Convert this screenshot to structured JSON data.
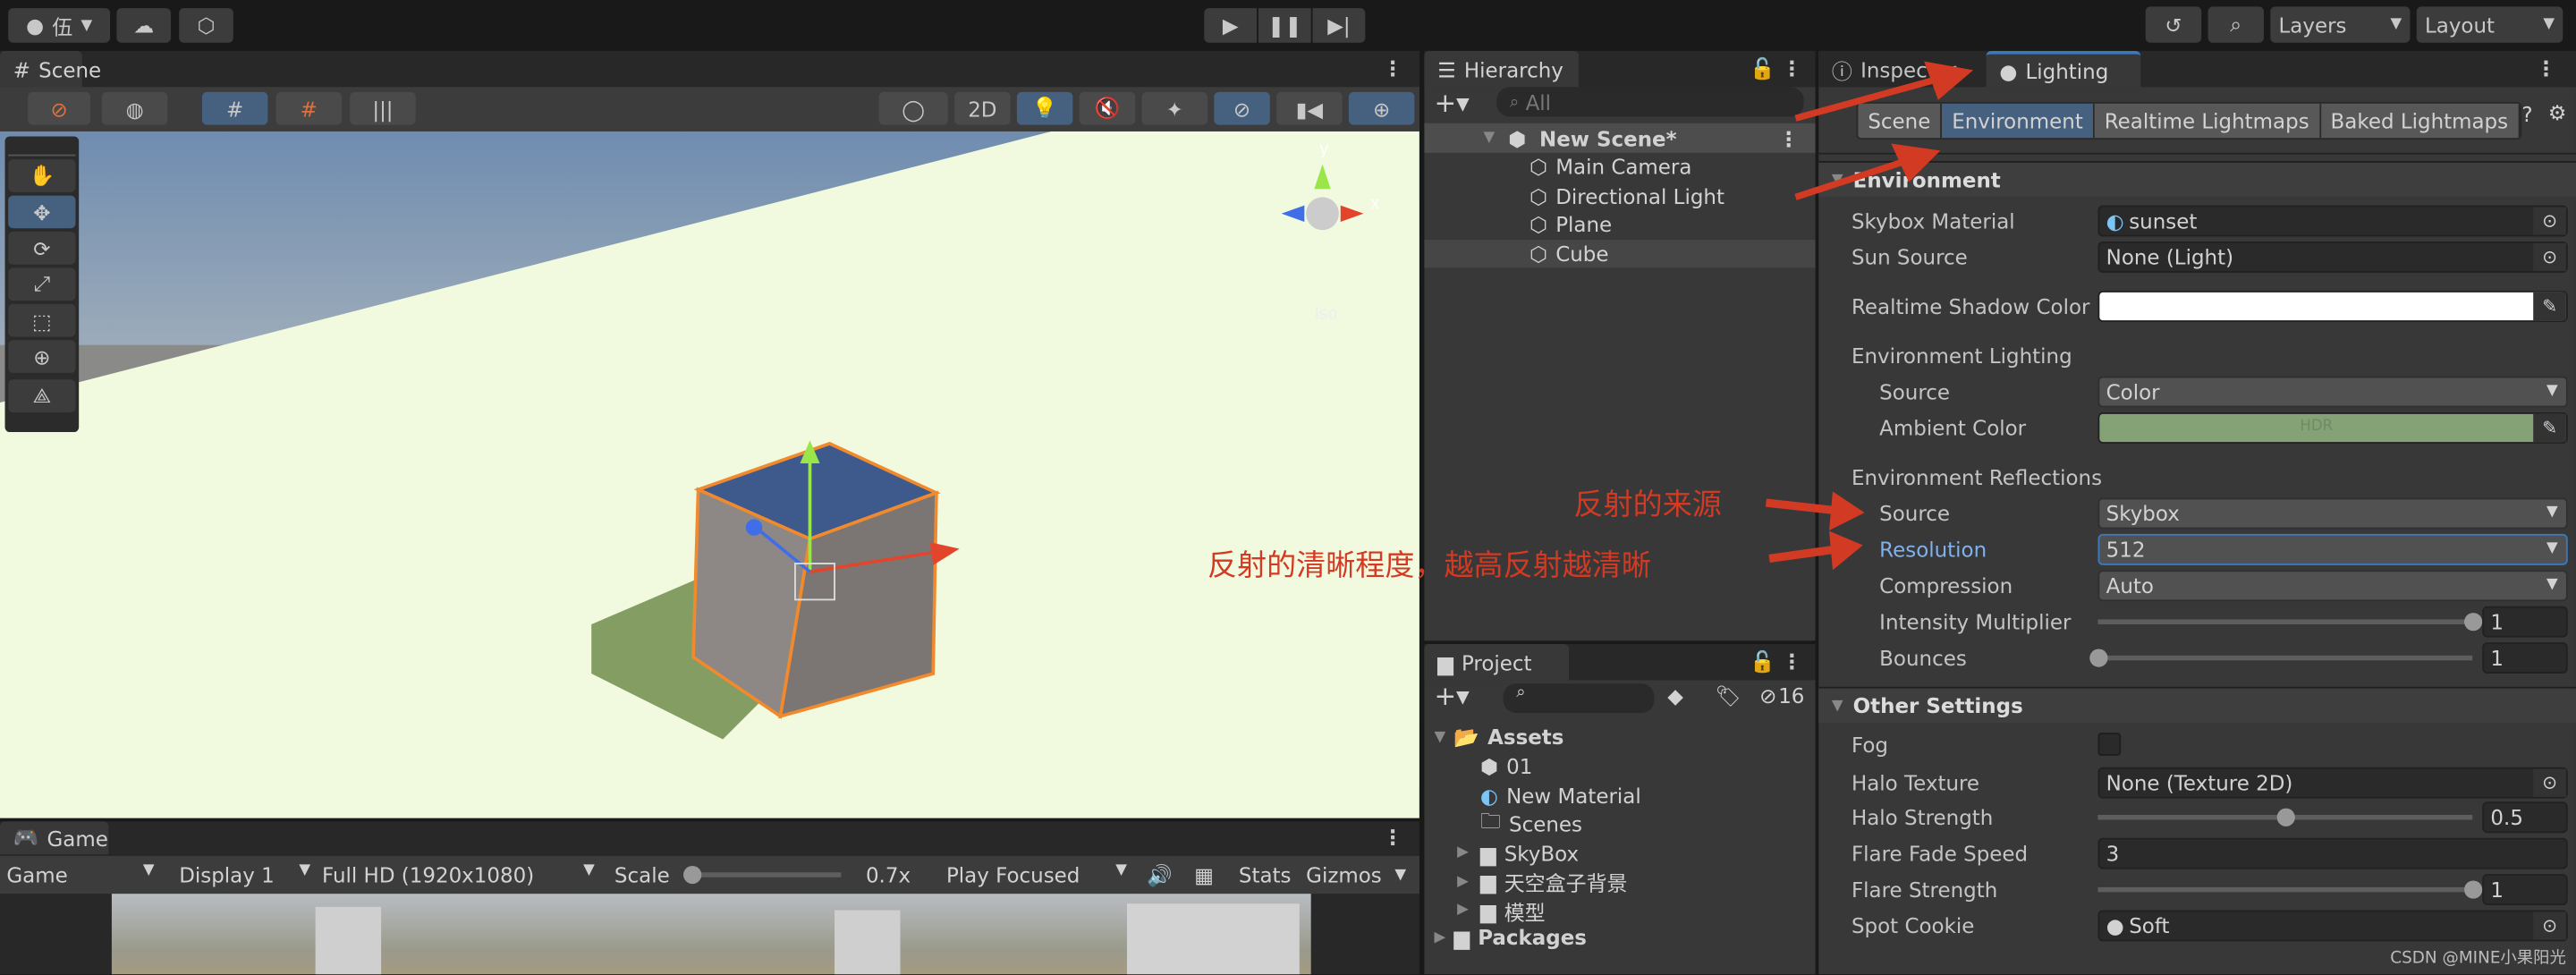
{
  "topbar": {
    "account_label": "伍",
    "layers": "Layers",
    "layout": "Layout"
  },
  "scene": {
    "tab": "Scene",
    "btn_2d": "2D",
    "gizmo_persp": "Iso",
    "gizmo_axes": {
      "x": "x",
      "y": "y"
    }
  },
  "game": {
    "tab": "Game",
    "view": "Game",
    "display": "Display 1",
    "resolution": "Full HD (1920x1080)",
    "scale_label": "Scale",
    "scale_value": "0.7x",
    "scale_fraction": 0.0,
    "play_mode": "Play Focused",
    "stats": "Stats",
    "gizmos": "Gizmos"
  },
  "hierarchy": {
    "tab": "Hierarchy",
    "search_placeholder": "All",
    "scene": "New Scene*",
    "items": [
      "Main Camera",
      "Directional Light",
      "Plane",
      "Cube"
    ],
    "selected": "Cube"
  },
  "project": {
    "tab": "Project",
    "hidden_count": "16",
    "root": "Assets",
    "items": [
      {
        "name": "01",
        "icon": "unity-scene-icon",
        "expandable": false
      },
      {
        "name": "New Material",
        "icon": "material-icon",
        "expandable": false
      },
      {
        "name": "Scenes",
        "icon": "folder-empty-icon",
        "expandable": false
      },
      {
        "name": "SkyBox",
        "icon": "folder-icon",
        "expandable": true
      },
      {
        "name": "天空盒子背景",
        "icon": "folder-icon",
        "expandable": true
      },
      {
        "name": "模型",
        "icon": "folder-icon",
        "expandable": true
      }
    ],
    "packages": "Packages"
  },
  "inspector": {
    "tab_inspector": "Inspector",
    "tab_lighting": "Lighting",
    "subtabs": [
      "Scene",
      "Environment",
      "Realtime Lightmaps",
      "Baked Lightmaps"
    ],
    "active_subtab": "Environment",
    "environment": {
      "header": "Environment",
      "skybox_label": "Skybox Material",
      "skybox_value": "sunset",
      "sun_label": "Sun Source",
      "sun_value": "None (Light)",
      "shadow_label": "Realtime Shadow Color",
      "shadow_color": "#ffffff",
      "lighting_header": "Environment Lighting",
      "source_label": "Source",
      "source_value": "Color",
      "ambient_label": "Ambient Color",
      "ambient_color": "#84a276",
      "ambient_hdr": "HDR",
      "reflections_header": "Environment Reflections",
      "refl_source_label": "Source",
      "refl_source_value": "Skybox",
      "resolution_label": "Resolution",
      "resolution_value": "512",
      "compression_label": "Compression",
      "compression_value": "Auto",
      "intensity_label": "Intensity Multiplier",
      "intensity_value": "1",
      "intensity_fraction": 1.0,
      "bounces_label": "Bounces",
      "bounces_value": "1",
      "bounces_fraction": 0.0
    },
    "other": {
      "header": "Other Settings",
      "fog_label": "Fog",
      "fog_checked": false,
      "halo_tex_label": "Halo Texture",
      "halo_tex_value": "None (Texture 2D)",
      "halo_strength_label": "Halo Strength",
      "halo_strength_value": "0.5",
      "halo_strength_fraction": 0.5,
      "flare_fade_label": "Flare Fade Speed",
      "flare_fade_value": "3",
      "flare_strength_label": "Flare Strength",
      "flare_strength_value": "1",
      "flare_strength_fraction": 1.0,
      "spot_cookie_label": "Spot Cookie",
      "spot_cookie_value": "Soft"
    }
  },
  "annotations": {
    "source_note": "反射的来源",
    "resolution_note": "反射的清晰程度，越高反射越清晰",
    "arrow_color": "#d33a23"
  },
  "watermark": "CSDN @MINE小果阳光"
}
